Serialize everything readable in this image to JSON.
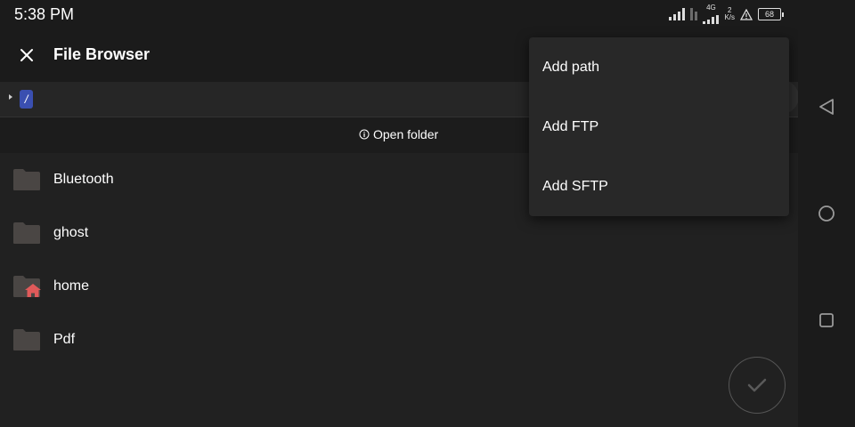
{
  "status_bar": {
    "time": "5:38 PM",
    "network_label": "4G",
    "speed_value": "2",
    "speed_unit": "K/s",
    "battery": "68"
  },
  "toolbar": {
    "title": "File Browser"
  },
  "path_bar": {
    "root": "/"
  },
  "open_folder": {
    "label": "Open folder"
  },
  "folders": [
    {
      "name": "Bluetooth",
      "icon": "folder-icon"
    },
    {
      "name": "ghost",
      "icon": "folder-icon"
    },
    {
      "name": "home",
      "icon": "folder-home-icon"
    },
    {
      "name": "Pdf",
      "icon": "folder-icon"
    }
  ],
  "menu": {
    "items": [
      "Add path",
      "Add FTP",
      "Add SFTP"
    ]
  },
  "colors": {
    "background": "#212121",
    "bar": "#1b1b1b",
    "accent_chip": "#3a4fb0",
    "folder": "#4a4644",
    "home_badge": "#e05a5a"
  }
}
